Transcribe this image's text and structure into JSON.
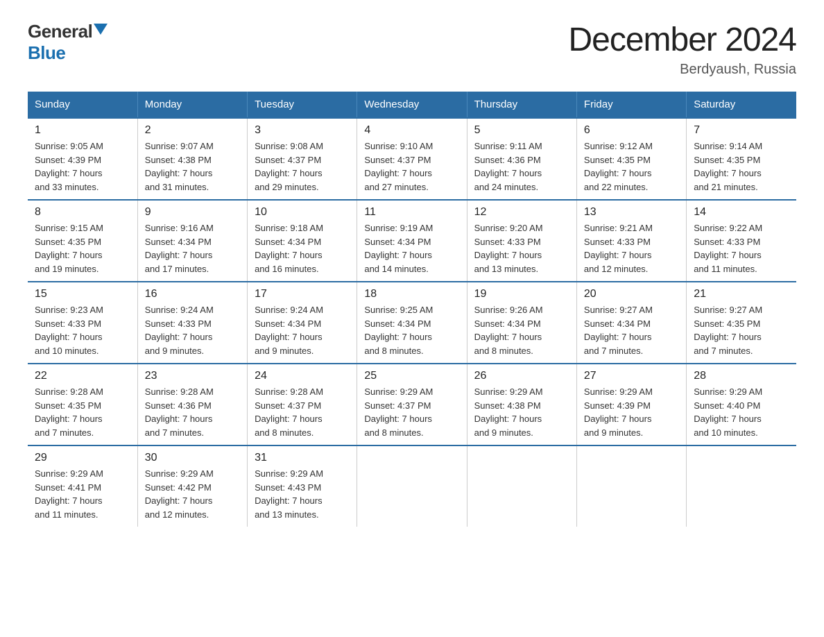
{
  "logo": {
    "general": "General",
    "blue": "Blue"
  },
  "title": "December 2024",
  "location": "Berdyaush, Russia",
  "days_of_week": [
    "Sunday",
    "Monday",
    "Tuesday",
    "Wednesday",
    "Thursday",
    "Friday",
    "Saturday"
  ],
  "weeks": [
    [
      {
        "day": "1",
        "info": "Sunrise: 9:05 AM\nSunset: 4:39 PM\nDaylight: 7 hours\nand 33 minutes."
      },
      {
        "day": "2",
        "info": "Sunrise: 9:07 AM\nSunset: 4:38 PM\nDaylight: 7 hours\nand 31 minutes."
      },
      {
        "day": "3",
        "info": "Sunrise: 9:08 AM\nSunset: 4:37 PM\nDaylight: 7 hours\nand 29 minutes."
      },
      {
        "day": "4",
        "info": "Sunrise: 9:10 AM\nSunset: 4:37 PM\nDaylight: 7 hours\nand 27 minutes."
      },
      {
        "day": "5",
        "info": "Sunrise: 9:11 AM\nSunset: 4:36 PM\nDaylight: 7 hours\nand 24 minutes."
      },
      {
        "day": "6",
        "info": "Sunrise: 9:12 AM\nSunset: 4:35 PM\nDaylight: 7 hours\nand 22 minutes."
      },
      {
        "day": "7",
        "info": "Sunrise: 9:14 AM\nSunset: 4:35 PM\nDaylight: 7 hours\nand 21 minutes."
      }
    ],
    [
      {
        "day": "8",
        "info": "Sunrise: 9:15 AM\nSunset: 4:35 PM\nDaylight: 7 hours\nand 19 minutes."
      },
      {
        "day": "9",
        "info": "Sunrise: 9:16 AM\nSunset: 4:34 PM\nDaylight: 7 hours\nand 17 minutes."
      },
      {
        "day": "10",
        "info": "Sunrise: 9:18 AM\nSunset: 4:34 PM\nDaylight: 7 hours\nand 16 minutes."
      },
      {
        "day": "11",
        "info": "Sunrise: 9:19 AM\nSunset: 4:34 PM\nDaylight: 7 hours\nand 14 minutes."
      },
      {
        "day": "12",
        "info": "Sunrise: 9:20 AM\nSunset: 4:33 PM\nDaylight: 7 hours\nand 13 minutes."
      },
      {
        "day": "13",
        "info": "Sunrise: 9:21 AM\nSunset: 4:33 PM\nDaylight: 7 hours\nand 12 minutes."
      },
      {
        "day": "14",
        "info": "Sunrise: 9:22 AM\nSunset: 4:33 PM\nDaylight: 7 hours\nand 11 minutes."
      }
    ],
    [
      {
        "day": "15",
        "info": "Sunrise: 9:23 AM\nSunset: 4:33 PM\nDaylight: 7 hours\nand 10 minutes."
      },
      {
        "day": "16",
        "info": "Sunrise: 9:24 AM\nSunset: 4:33 PM\nDaylight: 7 hours\nand 9 minutes."
      },
      {
        "day": "17",
        "info": "Sunrise: 9:24 AM\nSunset: 4:34 PM\nDaylight: 7 hours\nand 9 minutes."
      },
      {
        "day": "18",
        "info": "Sunrise: 9:25 AM\nSunset: 4:34 PM\nDaylight: 7 hours\nand 8 minutes."
      },
      {
        "day": "19",
        "info": "Sunrise: 9:26 AM\nSunset: 4:34 PM\nDaylight: 7 hours\nand 8 minutes."
      },
      {
        "day": "20",
        "info": "Sunrise: 9:27 AM\nSunset: 4:34 PM\nDaylight: 7 hours\nand 7 minutes."
      },
      {
        "day": "21",
        "info": "Sunrise: 9:27 AM\nSunset: 4:35 PM\nDaylight: 7 hours\nand 7 minutes."
      }
    ],
    [
      {
        "day": "22",
        "info": "Sunrise: 9:28 AM\nSunset: 4:35 PM\nDaylight: 7 hours\nand 7 minutes."
      },
      {
        "day": "23",
        "info": "Sunrise: 9:28 AM\nSunset: 4:36 PM\nDaylight: 7 hours\nand 7 minutes."
      },
      {
        "day": "24",
        "info": "Sunrise: 9:28 AM\nSunset: 4:37 PM\nDaylight: 7 hours\nand 8 minutes."
      },
      {
        "day": "25",
        "info": "Sunrise: 9:29 AM\nSunset: 4:37 PM\nDaylight: 7 hours\nand 8 minutes."
      },
      {
        "day": "26",
        "info": "Sunrise: 9:29 AM\nSunset: 4:38 PM\nDaylight: 7 hours\nand 9 minutes."
      },
      {
        "day": "27",
        "info": "Sunrise: 9:29 AM\nSunset: 4:39 PM\nDaylight: 7 hours\nand 9 minutes."
      },
      {
        "day": "28",
        "info": "Sunrise: 9:29 AM\nSunset: 4:40 PM\nDaylight: 7 hours\nand 10 minutes."
      }
    ],
    [
      {
        "day": "29",
        "info": "Sunrise: 9:29 AM\nSunset: 4:41 PM\nDaylight: 7 hours\nand 11 minutes."
      },
      {
        "day": "30",
        "info": "Sunrise: 9:29 AM\nSunset: 4:42 PM\nDaylight: 7 hours\nand 12 minutes."
      },
      {
        "day": "31",
        "info": "Sunrise: 9:29 AM\nSunset: 4:43 PM\nDaylight: 7 hours\nand 13 minutes."
      },
      {
        "day": "",
        "info": ""
      },
      {
        "day": "",
        "info": ""
      },
      {
        "day": "",
        "info": ""
      },
      {
        "day": "",
        "info": ""
      }
    ]
  ]
}
